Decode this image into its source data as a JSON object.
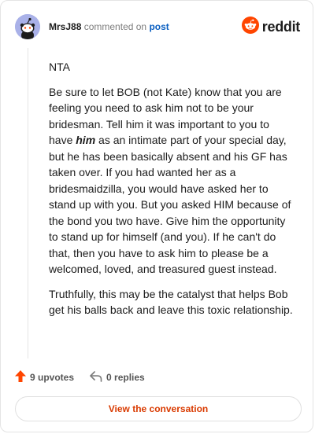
{
  "header": {
    "username": "MrsJ88",
    "action_text": "commented on",
    "post_link": "post",
    "brand_name": "reddit"
  },
  "comment": {
    "paragraphs": [
      {
        "text": "NTA"
      },
      {
        "before": "Be sure to let BOB (not Kate) know that you are feeling you need to ask him not to be your bridesman. Tell him it was important to you to have ",
        "emphasis": "him",
        "after": " as an intimate part of your special day, but he has been basically absent and his GF has taken over. If you had wanted her as a bridesmaidzilla, you would have asked her to stand up with you. But you asked HIM because of the bond you two have. Give him the opportunity to stand up for himself (and you). If he can't do that, then you have to ask him to please be a welcomed, loved, and treasured guest instead."
      },
      {
        "text": "Truthfully, this may be the catalyst that helps Bob get his balls back and leave this toxic relationship."
      }
    ]
  },
  "footer": {
    "upvotes": "9 upvotes",
    "replies": "0 replies",
    "cta_label": "View the conversation"
  },
  "icons": {
    "avatar": "snoo-avatar-icon",
    "brand": "reddit-logo-icon",
    "upvote": "upvote-arrow-icon",
    "reply": "reply-arrow-icon"
  },
  "colors": {
    "brand_orange": "#ff4500",
    "upvote_orange": "#ff4500",
    "link_blue": "#0a5fc1",
    "cta_text": "#d93a00"
  }
}
